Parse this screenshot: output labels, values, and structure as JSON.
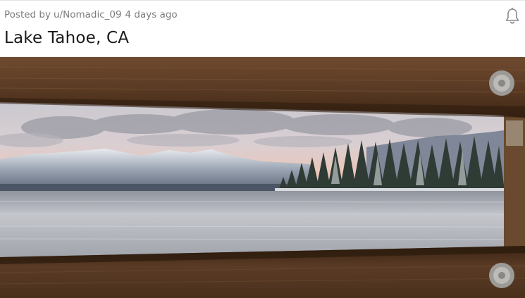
{
  "post": {
    "posted_by_label": "Posted by",
    "author": "u/Nomadic_09",
    "time_ago": "4 days ago",
    "title": "Lake Tahoe, CA"
  },
  "icons": {
    "notify": "bell-icon"
  },
  "image": {
    "alt": "Lake Tahoe, CA"
  },
  "colors": {
    "meta_text": "#7c7c7c",
    "title_text": "#1a1a1b",
    "wood": "#5a3a24",
    "lake": "#b9bcc3"
  }
}
